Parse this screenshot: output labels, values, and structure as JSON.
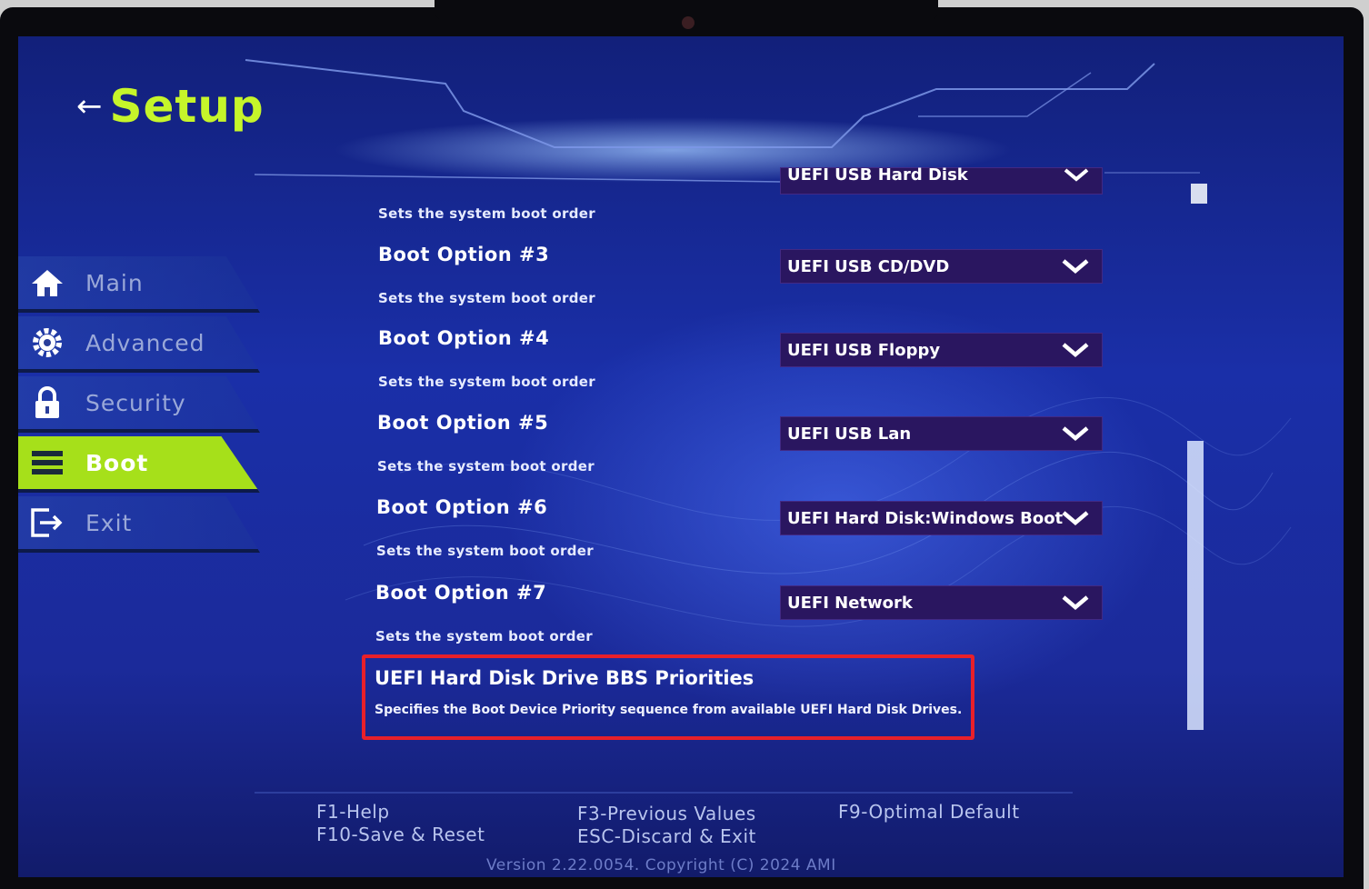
{
  "header": {
    "back_glyph": "←",
    "title": "Setup"
  },
  "nav": {
    "main": "Main",
    "advanced": "Advanced",
    "security": "Security",
    "boot": "Boot",
    "exit": "Exit",
    "active": "Boot"
  },
  "options": {
    "partial_value": "UEFI USB Hard Disk",
    "partial_sub": "Sets the system boot order",
    "opt3": {
      "label": "Boot Option #3",
      "sub": "Sets the system boot order",
      "value": "UEFI USB CD/DVD"
    },
    "opt4": {
      "label": "Boot Option #4",
      "sub": "Sets the system boot order",
      "value": "UEFI USB Floppy"
    },
    "opt5": {
      "label": "Boot Option #5",
      "sub": "Sets the system boot order",
      "value": "UEFI USB Lan"
    },
    "opt6": {
      "label": "Boot Option #6",
      "sub": "Sets the system boot order",
      "value": "UEFI Hard Disk:Windows Boot"
    },
    "opt7": {
      "label": "Boot Option #7",
      "sub": "Sets the system boot order",
      "value": "UEFI Network"
    }
  },
  "bbs": {
    "title": "UEFI Hard Disk Drive BBS Priorities",
    "desc": "Specifies the Boot Device Priority sequence from available UEFI Hard Disk Drives."
  },
  "footer": {
    "f1": "F1-Help",
    "f10": "F10-Save & Reset",
    "f3": "F3-Previous Values",
    "esc": "ESC-Discard & Exit",
    "f9": "F9-Optimal Default",
    "version": "Version 2.22.0054. Copyright (C) 2024 AMI"
  },
  "colors": {
    "accent": "#a6e01a",
    "title": "#c6f52a",
    "highlight": "#e8202a",
    "select_bg": "#2a1660"
  }
}
